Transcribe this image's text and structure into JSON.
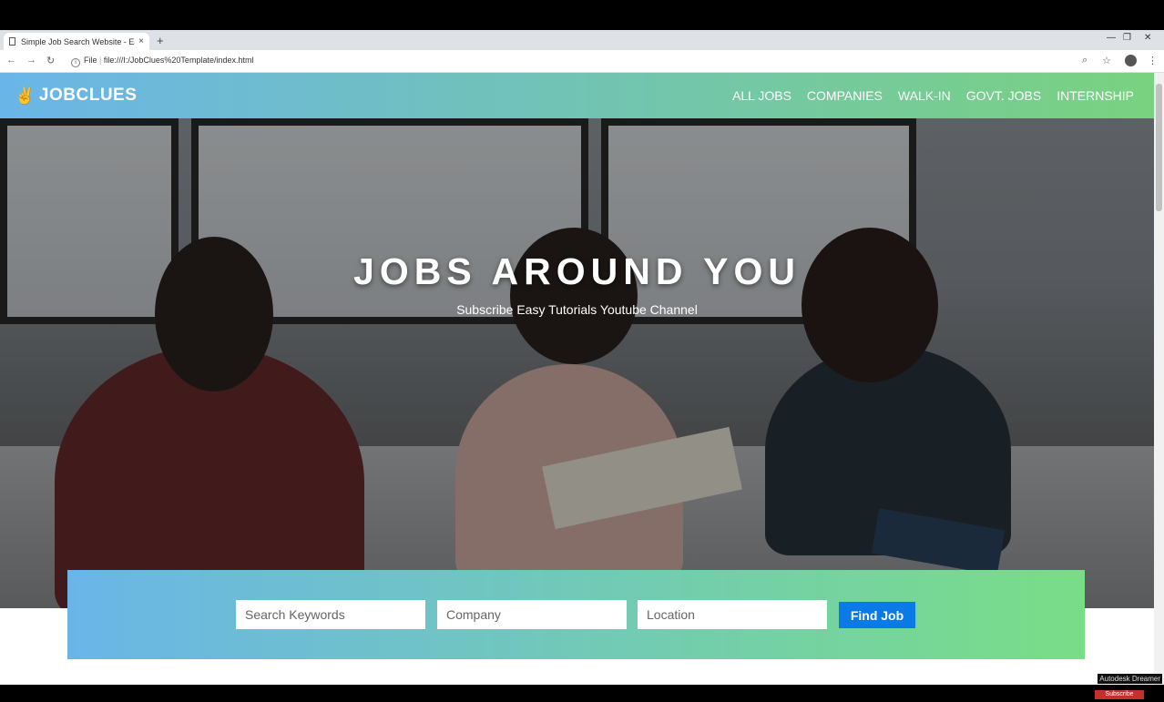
{
  "browser": {
    "tab_title": "Simple Job Search Website - Eas",
    "tab_close": "×",
    "new_tab": "+",
    "url_prefix": "File",
    "url": "file:///I:/JobClues%20Template/index.html"
  },
  "site": {
    "logo_text": "JOBCLUES",
    "nav": [
      "ALL JOBS",
      "COMPANIES",
      "WALK-IN",
      "GOVT. JOBS",
      "INTERNSHIP"
    ]
  },
  "hero": {
    "title": "JOBS AROUND YOU",
    "subtitle": "Subscribe Easy Tutorials Youtube Channel"
  },
  "search": {
    "keywords_placeholder": "Search Keywords",
    "company_placeholder": "Company",
    "location_placeholder": "Location",
    "button_label": "Find Job"
  },
  "overlay": {
    "watermark": "Autodesk Dreamer",
    "subscribe": "Subscribe"
  }
}
